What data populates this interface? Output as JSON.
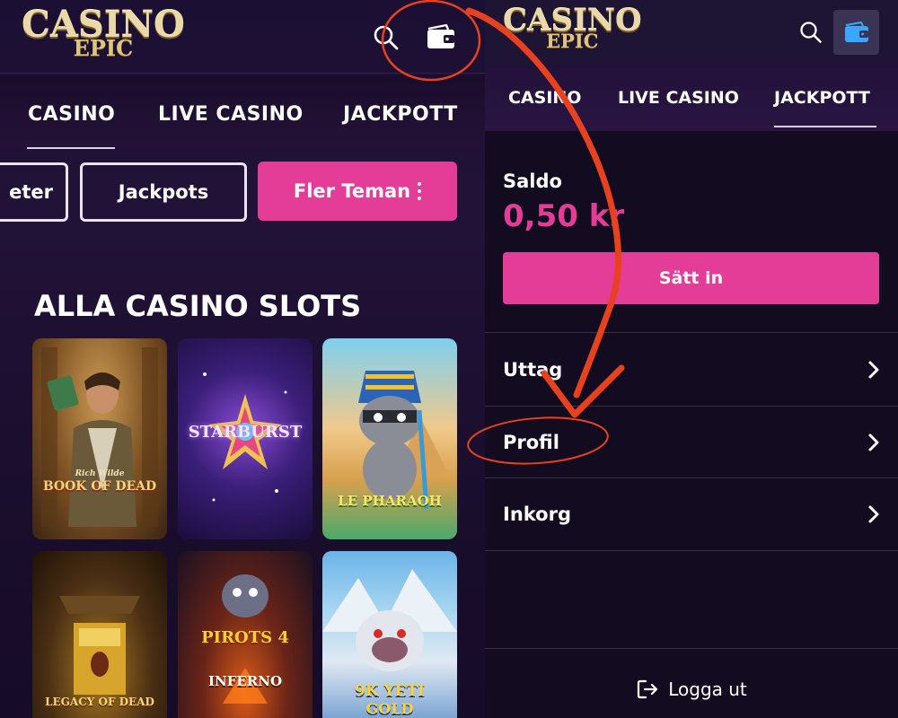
{
  "left": {
    "logo": {
      "line1": "CASINO",
      "line2": "EPIC"
    },
    "icons": {
      "search": "search-icon",
      "wallet": "wallet-icon"
    },
    "tabs": [
      {
        "label": "CASINO",
        "active": true
      },
      {
        "label": "LIVE CASINO"
      },
      {
        "label": "JACKPOTT"
      }
    ],
    "pills": {
      "partial": "eter",
      "jackpots": "Jackpots",
      "more_themes": "Fler Teman"
    },
    "section_title": "ALLA CASINO SLOTS",
    "games": [
      {
        "title_top": "Rich Wilde",
        "title": "BOOK OF DEAD"
      },
      {
        "title": "STARBURST"
      },
      {
        "title": "LE PHARAOH"
      },
      {
        "title": "LEGACY OF DEAD"
      },
      {
        "title_top": "PIROTS 4",
        "title": "INFERNO"
      },
      {
        "title_top": "9K YETI",
        "title": "GOLD"
      }
    ]
  },
  "right": {
    "logo": {
      "line1": "CASINO",
      "line2": "EPIC"
    },
    "icons": {
      "search": "search-icon",
      "wallet": "wallet-icon"
    },
    "tabs": [
      {
        "label": "CASINO"
      },
      {
        "label": "LIVE CASINO"
      },
      {
        "label": "JACKPOTT",
        "active": true
      }
    ],
    "balance": {
      "label": "Saldo",
      "value": "0,50 kr"
    },
    "deposit_label": "Sätt in",
    "menu": [
      {
        "label": "Uttag"
      },
      {
        "label": "Profil",
        "highlighted": true
      },
      {
        "label": "Inkorg"
      }
    ],
    "logout_label": "Logga ut"
  },
  "colors": {
    "accent_pink": "#e43d97",
    "annotation_red": "#e8411f",
    "wallet_active_blue": "#3aa8ff"
  }
}
